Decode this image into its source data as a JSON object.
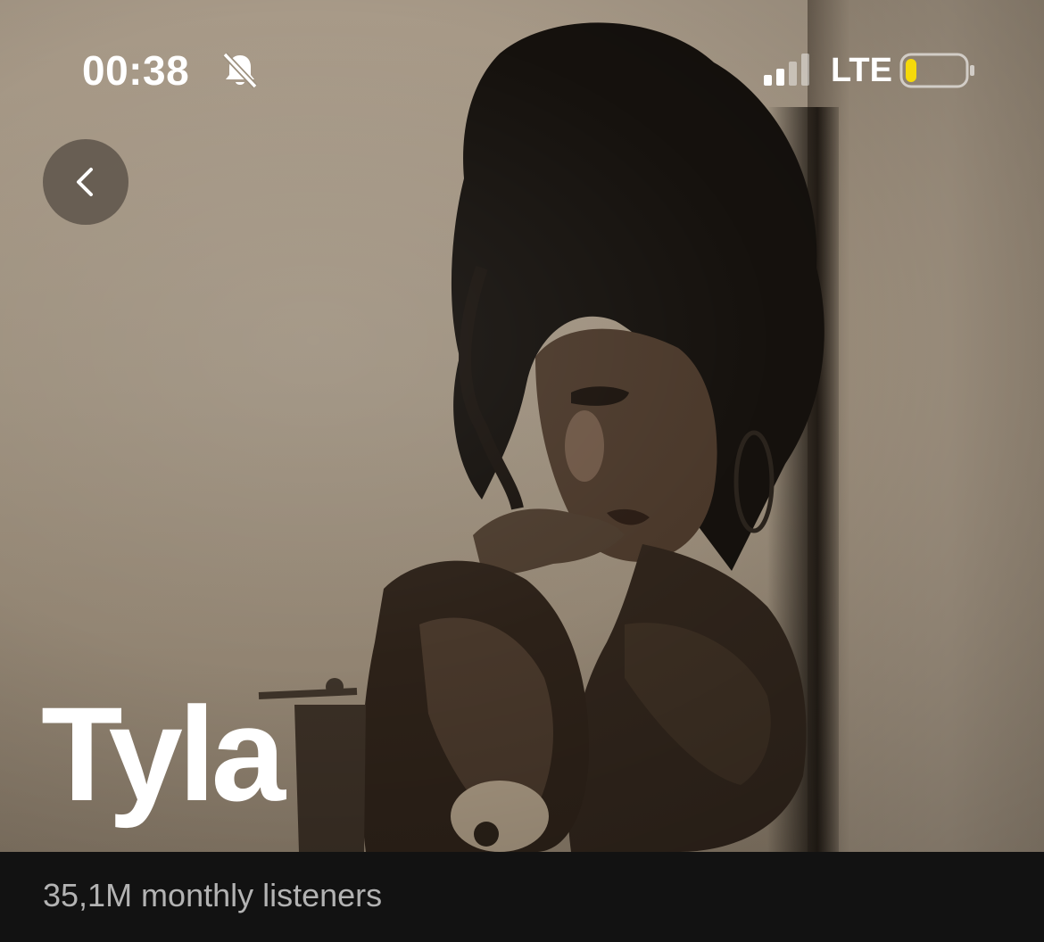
{
  "status_bar": {
    "time": "00:38",
    "network": "LTE",
    "icons": [
      "bell-muted-icon",
      "signal-icon",
      "battery-low-icon"
    ]
  },
  "nav": {
    "back_icon": "chevron-left-icon"
  },
  "artist": {
    "name": "Tyla",
    "monthly_listeners": "35,1M monthly listeners"
  },
  "colors": {
    "hero_tone": "#a89a88",
    "background": "#121212",
    "battery_level": "#f5d90a",
    "secondary_text": "#b3b3b3"
  }
}
